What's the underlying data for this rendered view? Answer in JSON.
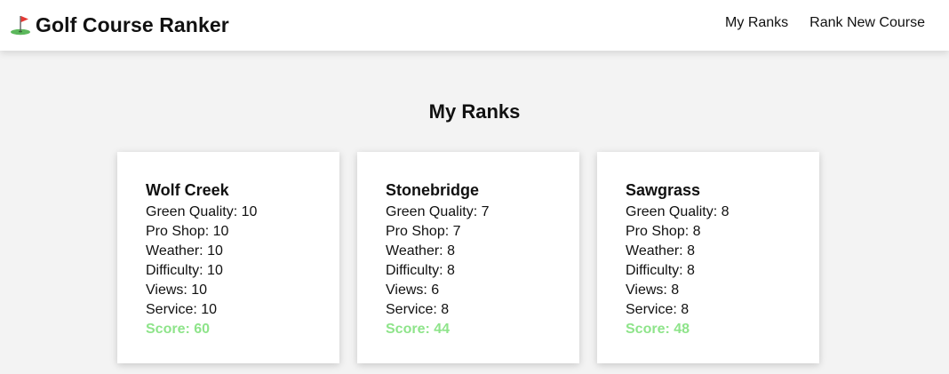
{
  "header": {
    "brand_title": "Golf Course Ranker",
    "brand_icon": "golf-flag-icon",
    "nav": [
      {
        "label": "My Ranks"
      },
      {
        "label": "Rank New Course"
      }
    ]
  },
  "main": {
    "title": "My Ranks",
    "score_color": "#8ee48a",
    "courses": [
      {
        "name": "Wolf Creek",
        "green_quality": "Green Quality: 10",
        "pro_shop": "Pro Shop: 10",
        "weather": "Weather: 10",
        "difficulty": "Difficulty: 10",
        "views": "Views: 10",
        "service": "Service: 10",
        "score": "Score: 60"
      },
      {
        "name": "Stonebridge",
        "green_quality": "Green Quality: 7",
        "pro_shop": "Pro Shop: 7",
        "weather": "Weather: 8",
        "difficulty": "Difficulty: 8",
        "views": "Views: 6",
        "service": "Service: 8",
        "score": "Score: 44"
      },
      {
        "name": "Sawgrass",
        "green_quality": "Green Quality: 8",
        "pro_shop": "Pro Shop: 8",
        "weather": "Weather: 8",
        "difficulty": "Difficulty: 8",
        "views": "Views: 8",
        "service": "Service: 8",
        "score": "Score: 48"
      }
    ]
  }
}
